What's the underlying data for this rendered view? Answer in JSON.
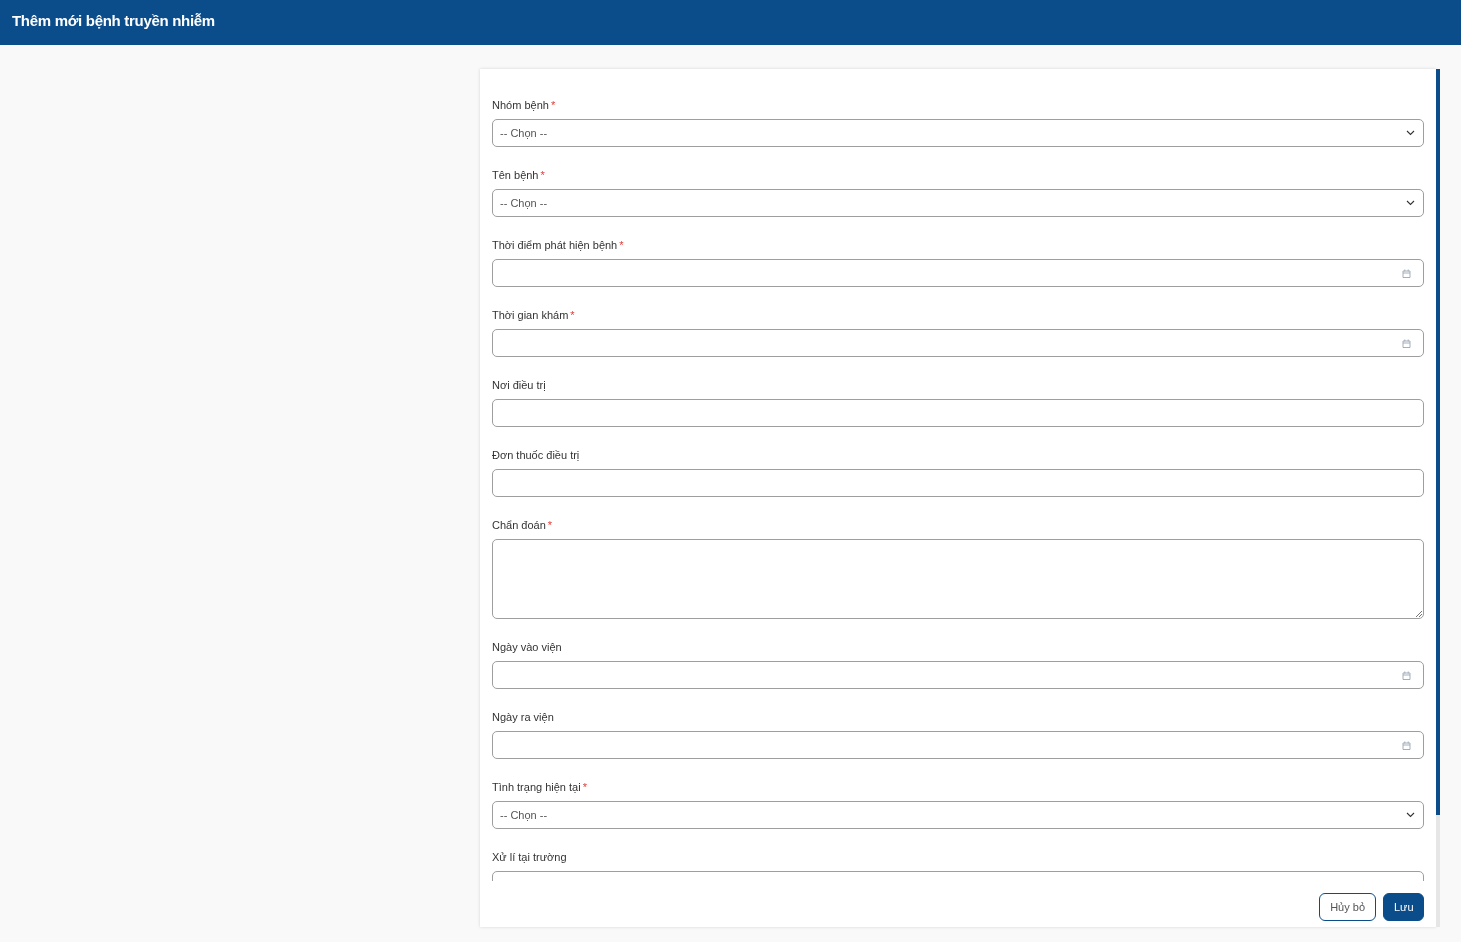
{
  "header": {
    "title": "Thêm mới bệnh truyền nhiễm"
  },
  "form": {
    "fields": [
      {
        "label": "Nhóm bệnh",
        "required_mark": "*",
        "kind": "select",
        "placeholder": "-- Chọn --"
      },
      {
        "label": "Tên bệnh",
        "required_mark": "*",
        "kind": "select",
        "placeholder": "-- Chọn --"
      },
      {
        "label": "Thời điểm phát hiện bệnh",
        "required_mark": "*",
        "kind": "date"
      },
      {
        "label": "Thời gian khám",
        "required_mark": "*",
        "kind": "date"
      },
      {
        "label": "Nơi điều trị",
        "kind": "text"
      },
      {
        "label": "Đơn thuốc điều trị",
        "kind": "text"
      },
      {
        "label": "Chẩn đoán",
        "required_mark": "*",
        "kind": "textarea"
      },
      {
        "label": "Ngày vào viện",
        "kind": "date"
      },
      {
        "label": "Ngày ra viện",
        "kind": "date"
      },
      {
        "label": "Tình trạng hiện tại",
        "required_mark": "*",
        "kind": "select",
        "placeholder": "-- Chọn --"
      },
      {
        "label": "Xử lí tại trường",
        "kind": "text"
      }
    ]
  },
  "buttons": [
    {
      "label": "Hủy bỏ",
      "kind": "secondary"
    },
    {
      "label": "Lưu",
      "kind": "primary"
    }
  ]
}
